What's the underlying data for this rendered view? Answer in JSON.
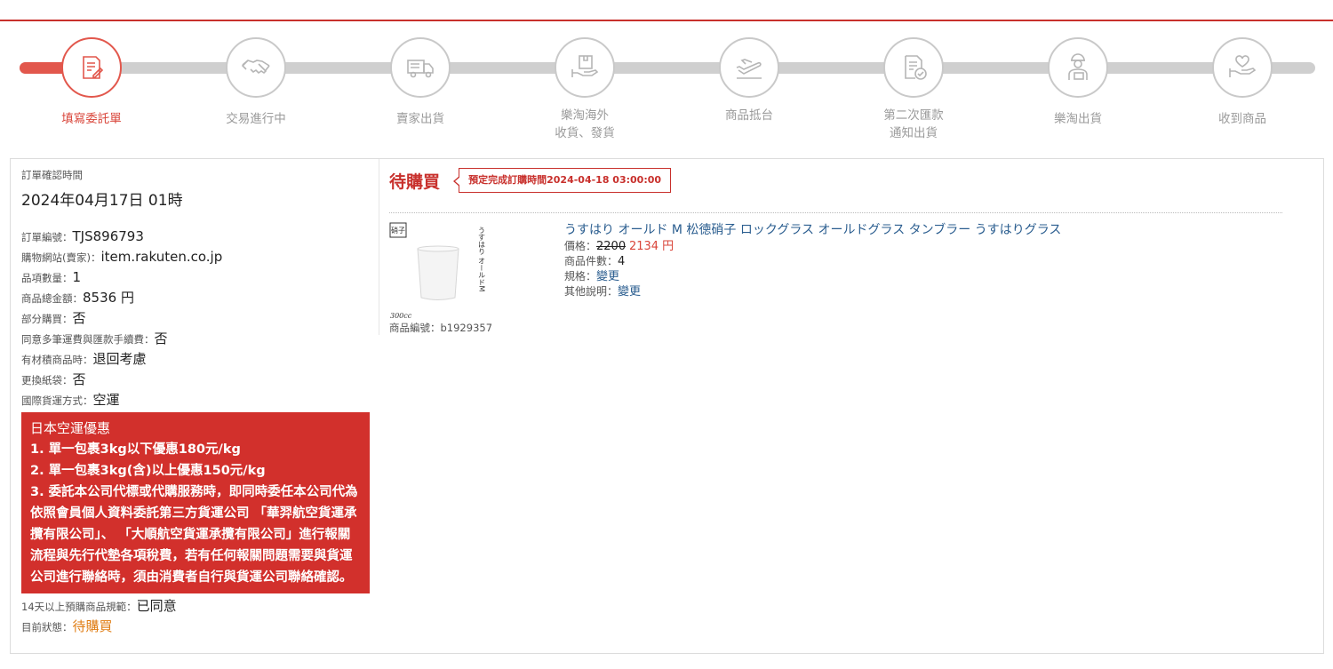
{
  "steps": [
    {
      "label": "填寫委託單",
      "label2": "",
      "icon": "form-edit-icon",
      "active": true
    },
    {
      "label": "交易進行中",
      "label2": "",
      "icon": "handshake-icon",
      "active": false
    },
    {
      "label": "賣家出貨",
      "label2": "",
      "icon": "truck-icon",
      "active": false
    },
    {
      "label": "樂淘海外",
      "label2": "收貨、發貨",
      "icon": "package-hand-icon",
      "active": false
    },
    {
      "label": "商品抵台",
      "label2": "",
      "icon": "airplane-icon",
      "active": false
    },
    {
      "label": "第二次匯款",
      "label2": "通知出貨",
      "icon": "document-check-icon",
      "active": false
    },
    {
      "label": "樂淘出貨",
      "label2": "",
      "icon": "delivery-person-icon",
      "active": false
    },
    {
      "label": "收到商品",
      "label2": "",
      "icon": "heart-hand-icon",
      "active": false
    }
  ],
  "order": {
    "confirm_time_label": "訂單確認時間",
    "confirm_time": "2024年04月17日 01時",
    "fields": [
      {
        "key": "訂單編號：",
        "value": "TJS896793"
      },
      {
        "key": "購物網站(賣家)：",
        "value": "item.rakuten.co.jp"
      },
      {
        "key": "品項數量：",
        "value": "1"
      },
      {
        "key": "商品總金額：",
        "value": "8536 円"
      },
      {
        "key": "部分購買：",
        "value": "否"
      },
      {
        "key": "同意多筆運費與匯款手續費：",
        "value": "否"
      },
      {
        "key": "有材積商品時：",
        "value": "退回考慮"
      },
      {
        "key": "更換紙袋：",
        "value": "否"
      },
      {
        "key": "國際貨運方式：",
        "value": "空運"
      }
    ],
    "promo_title": "日本空運優惠",
    "promo_lines": [
      "1. 單一包裹3kg以下優惠180元/kg",
      "2. 單一包裹3kg(含)以上優惠150元/kg",
      "3. 委託本公司代標或代購服務時，即同時委任本公司代為依照會員個人資料委託第三方貨運公司 「華羿航空貨運承攬有限公司」、 「大順航空貨運承攬有限公司」進行報關流程與先行代墊各項稅費，若有任何報關問題需要與貨運公司進行聯絡時，須由消費者自行與貨運公司聯絡確認。"
    ],
    "preorder_key": "14天以上預購商品規範：",
    "preorder_value": "已同意",
    "status_key": "目前狀態：",
    "status_value": "待購買"
  },
  "right": {
    "status": "待購買",
    "deadline": "預定完成訂購時間2024-04-18 03:00:00"
  },
  "product": {
    "thumb_text_top_left": "硝子",
    "thumb_text_vertical": "うすはり オールドM",
    "thumb_text_bottom": "300cc",
    "code_label": "商品編號：",
    "code": "b1929357",
    "title": "うすはり オールド M 松徳硝子 ロックグラス オールドグラス タンブラー うすはりグラス",
    "price_label": "價格：",
    "price_original": "2200",
    "price_current": "2134 円",
    "qty_label": "商品件數：",
    "qty": "4",
    "spec_label": "規格：",
    "spec_value": "變更",
    "note_label": "其他說明：",
    "note_value": "變更"
  },
  "colors": {
    "accent": "#c8302c",
    "step_active": "#e2574c",
    "link": "#2a5d8f",
    "orange": "#e07d14"
  }
}
